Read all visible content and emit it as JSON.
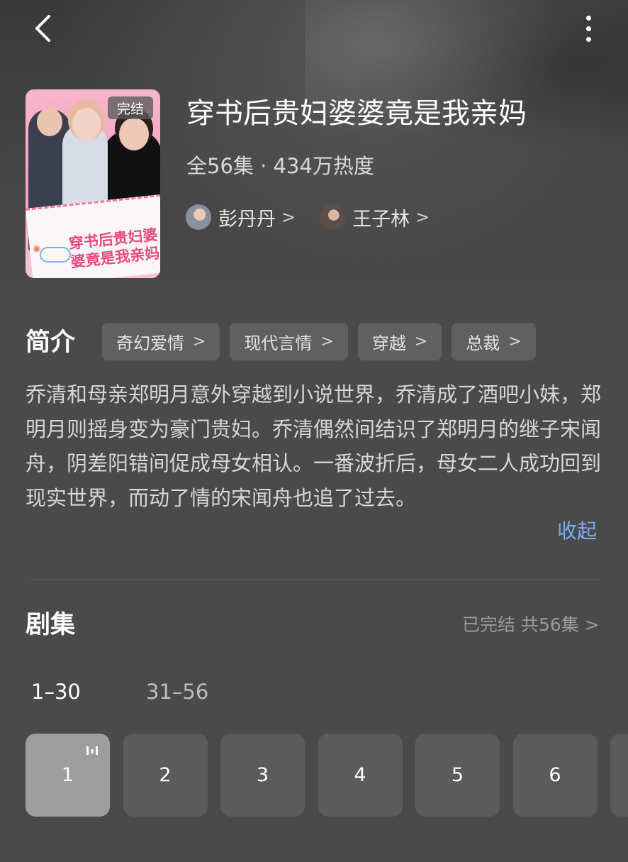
{
  "nav": {
    "back_icon": "chevron-left-icon",
    "more_icon": "more-vertical-icon"
  },
  "show": {
    "poster": {
      "badge": "完结",
      "title_art": "穿书后贵妇婆婆竟是我亲妈"
    },
    "title": "穿书后贵妇婆婆竟是我亲妈",
    "meta": "全56集 · 434万热度",
    "actors": [
      {
        "name": "彭丹丹",
        "chevron": ">"
      },
      {
        "name": "王子林",
        "chevron": ">"
      }
    ]
  },
  "intro": {
    "label": "简介",
    "tags": [
      {
        "label": "奇幻爱情",
        "chevron": ">"
      },
      {
        "label": "现代言情",
        "chevron": ">"
      },
      {
        "label": "穿越",
        "chevron": ">"
      },
      {
        "label": "总裁",
        "chevron": ">"
      }
    ],
    "description": "乔清和母亲郑明月意外穿越到小说世界，乔清成了酒吧小妹，郑明月则摇身变为豪门贵妇。乔清偶然间结识了郑明月的继子宋闻舟，阴差阳错间促成母女相认。一番波折后，母女二人成功回到现实世界，而动了情的宋闻舟也追了过去。",
    "collapse_label": "收起"
  },
  "episodes": {
    "label": "剧集",
    "status": "已完结 共56集 >",
    "ranges": [
      {
        "label": "1–30",
        "selected": true
      },
      {
        "label": "31–56",
        "selected": false
      }
    ],
    "items": [
      {
        "number": "1",
        "playing": true
      },
      {
        "number": "2",
        "playing": false
      },
      {
        "number": "3",
        "playing": false
      },
      {
        "number": "4",
        "playing": false
      },
      {
        "number": "5",
        "playing": false
      },
      {
        "number": "6",
        "playing": false
      }
    ]
  },
  "colors": {
    "background": "#4a4a4a",
    "accent_link": "#78aef0",
    "tag_bg": "#606060",
    "episode_bg": "#5b5b5b",
    "episode_active_bg": "#9d9d9d"
  }
}
